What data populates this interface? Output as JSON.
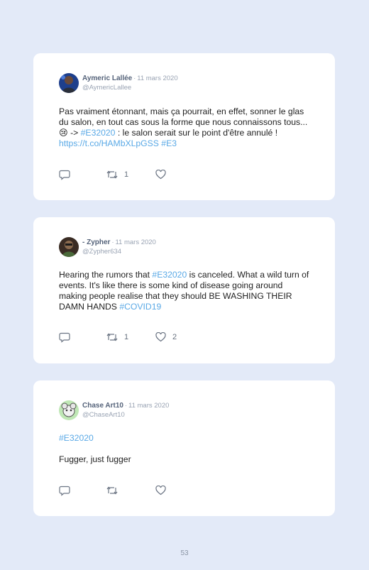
{
  "tweets": [
    {
      "name": "Aymeric Lallée",
      "separator": "·",
      "date": "11 mars 2020",
      "handle": "@AymericLallee",
      "text": {
        "p1": "Pas vraiment étonnant, mais ça pourrait, en effet, sonner le glas du salon, en tout cas sous la forme que nous connaissons tous... 😢 -> ",
        "hashtag1": "#E32020",
        "p2": " : le salon serait sur le point d'être annulé ! ",
        "link": "https://t.co/HAMbXLpGSS",
        "p3": " ",
        "hashtag2": "#E3"
      },
      "retweets": "1",
      "likes": ""
    },
    {
      "name": "- Zypher",
      "separator": "·",
      "date": "11 mars 2020",
      "handle": "@Zypher634",
      "text": {
        "p1": "Hearing the rumors that ",
        "hashtag1": "#E32020",
        "p2": " is canceled. What a wild turn of events. It's like there is some kind of disease going around making people realise that they should BE WASHING THEIR DAMN HANDS ",
        "hashtag2": "#COVID19"
      },
      "retweets": "1",
      "likes": "2"
    },
    {
      "name": "Chase Art10",
      "separator": "·",
      "date": "11 mars 2020",
      "handle": "@ChaseArt10",
      "text": {
        "hashtag1": "#E32020",
        "body": "Fugger, just fugger"
      },
      "retweets": "",
      "likes": ""
    }
  ],
  "page_number": "53",
  "colors": {
    "background": "#e3eaf8",
    "card": "#ffffff",
    "link": "#5aa9e6",
    "name": "#55637a",
    "muted": "#99a3b3"
  },
  "icons": [
    "reply-icon",
    "retweet-icon",
    "like-icon"
  ]
}
